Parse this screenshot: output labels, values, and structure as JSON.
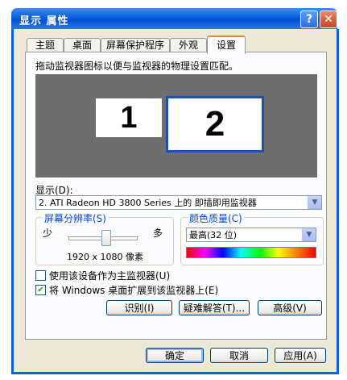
{
  "window": {
    "title": "显示 属性",
    "help_label": "?",
    "close_label": "✕"
  },
  "tabs": [
    {
      "label": "主题"
    },
    {
      "label": "桌面"
    },
    {
      "label": "屏幕保护程序"
    },
    {
      "label": "外观"
    },
    {
      "label": "设置",
      "active": true
    }
  ],
  "settings": {
    "description": "拖动监视器图标以便与监视器的物理设置匹配。",
    "monitors": [
      {
        "label": "1"
      },
      {
        "label": "2",
        "selected": true
      }
    ],
    "display_label": "显示(D):",
    "display_value": "2. ATI Radeon HD 3800 Series  上的 即插即用监视器",
    "resolution": {
      "label": "屏幕分辨率(S)",
      "min_label": "少",
      "max_label": "多",
      "value_text": "1920 x 1080 像素",
      "slider_position": 0.55
    },
    "color_quality": {
      "label": "颜色质量(C)",
      "value": "最高(32 位)"
    },
    "primary_checkbox": {
      "label": "使用该设备作为主监视器(U)",
      "checked": false
    },
    "extend_checkbox": {
      "label": "将 Windows 桌面扩展到该监视器上(E)",
      "checked": true
    },
    "identify_label": "识别(I)",
    "troubleshoot_label": "疑难解答(T)...",
    "advanced_label": "高级(V)"
  },
  "footer": {
    "ok_label": "确定",
    "cancel_label": "取消",
    "apply_label": "应用(A)"
  },
  "colors": {
    "title_blue": "#0a5fe0",
    "face": "#ece9d8",
    "selected_border": "#1f4fb0"
  }
}
